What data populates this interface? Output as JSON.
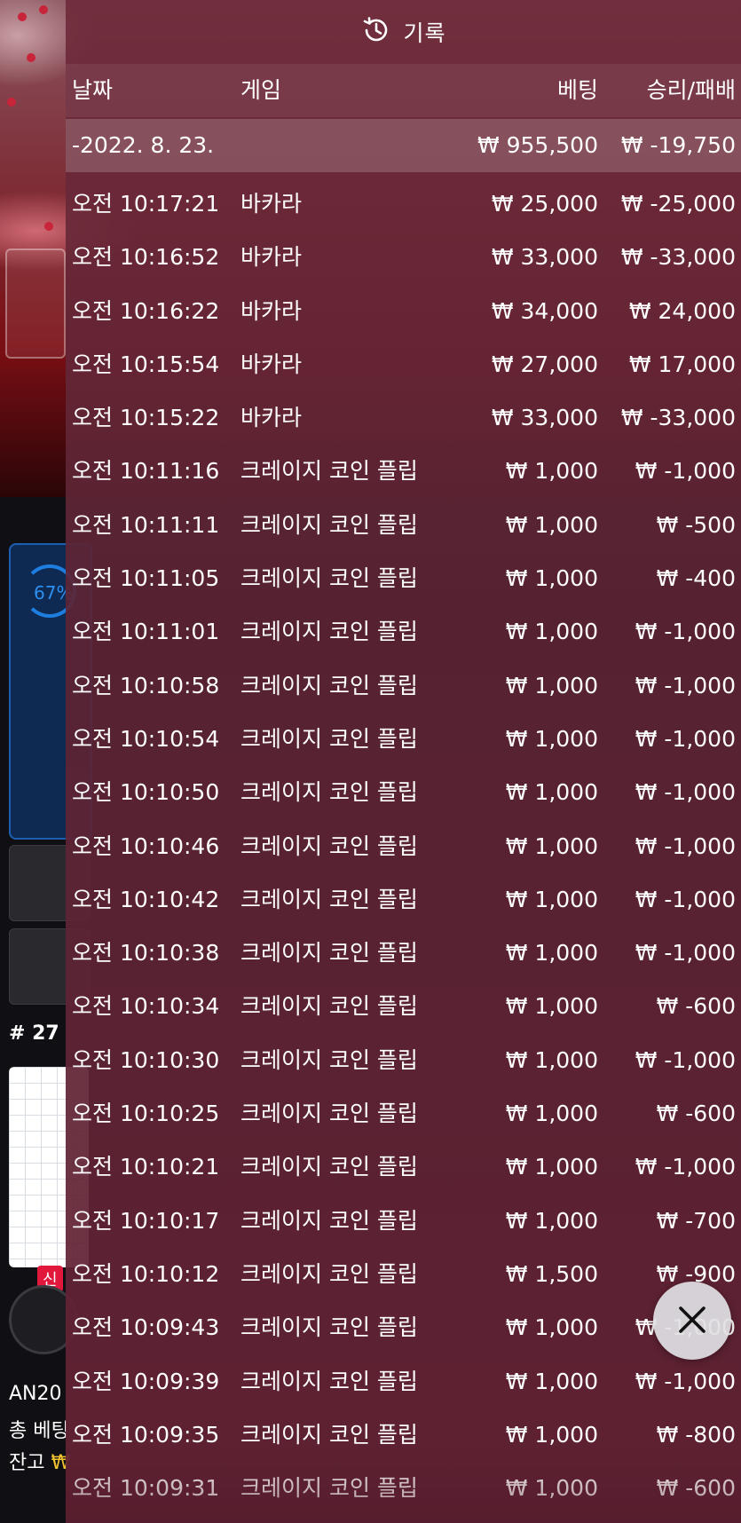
{
  "header": {
    "title": "기록",
    "icon": "history-icon"
  },
  "columns": {
    "date": "날짜",
    "game": "게임",
    "bet": "베팅",
    "win_loss": "승리/패배"
  },
  "summary": {
    "date": "-2022. 8. 23.",
    "bet": "₩ 955,500",
    "win_loss": "₩ -19,750"
  },
  "rows": [
    {
      "time": "오전 10:17:21",
      "game": "바카라",
      "bet": "₩ 25,000",
      "win_loss": "₩ -25,000"
    },
    {
      "time": "오전 10:16:52",
      "game": "바카라",
      "bet": "₩ 33,000",
      "win_loss": "₩ -33,000"
    },
    {
      "time": "오전 10:16:22",
      "game": "바카라",
      "bet": "₩ 34,000",
      "win_loss": "₩ 24,000"
    },
    {
      "time": "오전 10:15:54",
      "game": "바카라",
      "bet": "₩ 27,000",
      "win_loss": "₩ 17,000"
    },
    {
      "time": "오전 10:15:22",
      "game": "바카라",
      "bet": "₩ 33,000",
      "win_loss": "₩ -33,000"
    },
    {
      "time": "오전 10:11:16",
      "game": "크레이지 코인 플립",
      "bet": "₩ 1,000",
      "win_loss": "₩ -1,000"
    },
    {
      "time": "오전 10:11:11",
      "game": "크레이지 코인 플립",
      "bet": "₩ 1,000",
      "win_loss": "₩ -500"
    },
    {
      "time": "오전 10:11:05",
      "game": "크레이지 코인 플립",
      "bet": "₩ 1,000",
      "win_loss": "₩ -400"
    },
    {
      "time": "오전 10:11:01",
      "game": "크레이지 코인 플립",
      "bet": "₩ 1,000",
      "win_loss": "₩ -1,000"
    },
    {
      "time": "오전 10:10:58",
      "game": "크레이지 코인 플립",
      "bet": "₩ 1,000",
      "win_loss": "₩ -1,000"
    },
    {
      "time": "오전 10:10:54",
      "game": "크레이지 코인 플립",
      "bet": "₩ 1,000",
      "win_loss": "₩ -1,000"
    },
    {
      "time": "오전 10:10:50",
      "game": "크레이지 코인 플립",
      "bet": "₩ 1,000",
      "win_loss": "₩ -1,000"
    },
    {
      "time": "오전 10:10:46",
      "game": "크레이지 코인 플립",
      "bet": "₩ 1,000",
      "win_loss": "₩ -1,000"
    },
    {
      "time": "오전 10:10:42",
      "game": "크레이지 코인 플립",
      "bet": "₩ 1,000",
      "win_loss": "₩ -1,000"
    },
    {
      "time": "오전 10:10:38",
      "game": "크레이지 코인 플립",
      "bet": "₩ 1,000",
      "win_loss": "₩ -1,000"
    },
    {
      "time": "오전 10:10:34",
      "game": "크레이지 코인 플립",
      "bet": "₩ 1,000",
      "win_loss": "₩ -600"
    },
    {
      "time": "오전 10:10:30",
      "game": "크레이지 코인 플립",
      "bet": "₩ 1,000",
      "win_loss": "₩ -1,000"
    },
    {
      "time": "오전 10:10:25",
      "game": "크레이지 코인 플립",
      "bet": "₩ 1,000",
      "win_loss": "₩ -600"
    },
    {
      "time": "오전 10:10:21",
      "game": "크레이지 코인 플립",
      "bet": "₩ 1,000",
      "win_loss": "₩ -1,000"
    },
    {
      "time": "오전 10:10:17",
      "game": "크레이지 코인 플립",
      "bet": "₩ 1,000",
      "win_loss": "₩ -700"
    },
    {
      "time": "오전 10:10:12",
      "game": "크레이지 코인 플립",
      "bet": "₩ 1,500",
      "win_loss": "₩ -900"
    },
    {
      "time": "오전 10:09:43",
      "game": "크레이지 코인 플립",
      "bet": "₩ 1,000",
      "win_loss": "₩ -1,000"
    },
    {
      "time": "오전 10:09:39",
      "game": "크레이지 코인 플립",
      "bet": "₩ 1,000",
      "win_loss": "₩ -1,000"
    },
    {
      "time": "오전 10:09:35",
      "game": "크레이지 코인 플립",
      "bet": "₩ 1,000",
      "win_loss": "₩ -800"
    },
    {
      "time": "오전 10:09:31",
      "game": "크레이지 코인 플립",
      "bet": "₩ 1,000",
      "win_loss": "₩ -600"
    }
  ],
  "close_button": {
    "icon": "close-icon"
  },
  "background": {
    "progress_label": "67%",
    "table_number": "# 27",
    "new_badge": "신",
    "account_label": "AN20",
    "total_bet_label": "총 베팅",
    "balance_label": "잔고",
    "balance_currency": "₩"
  }
}
